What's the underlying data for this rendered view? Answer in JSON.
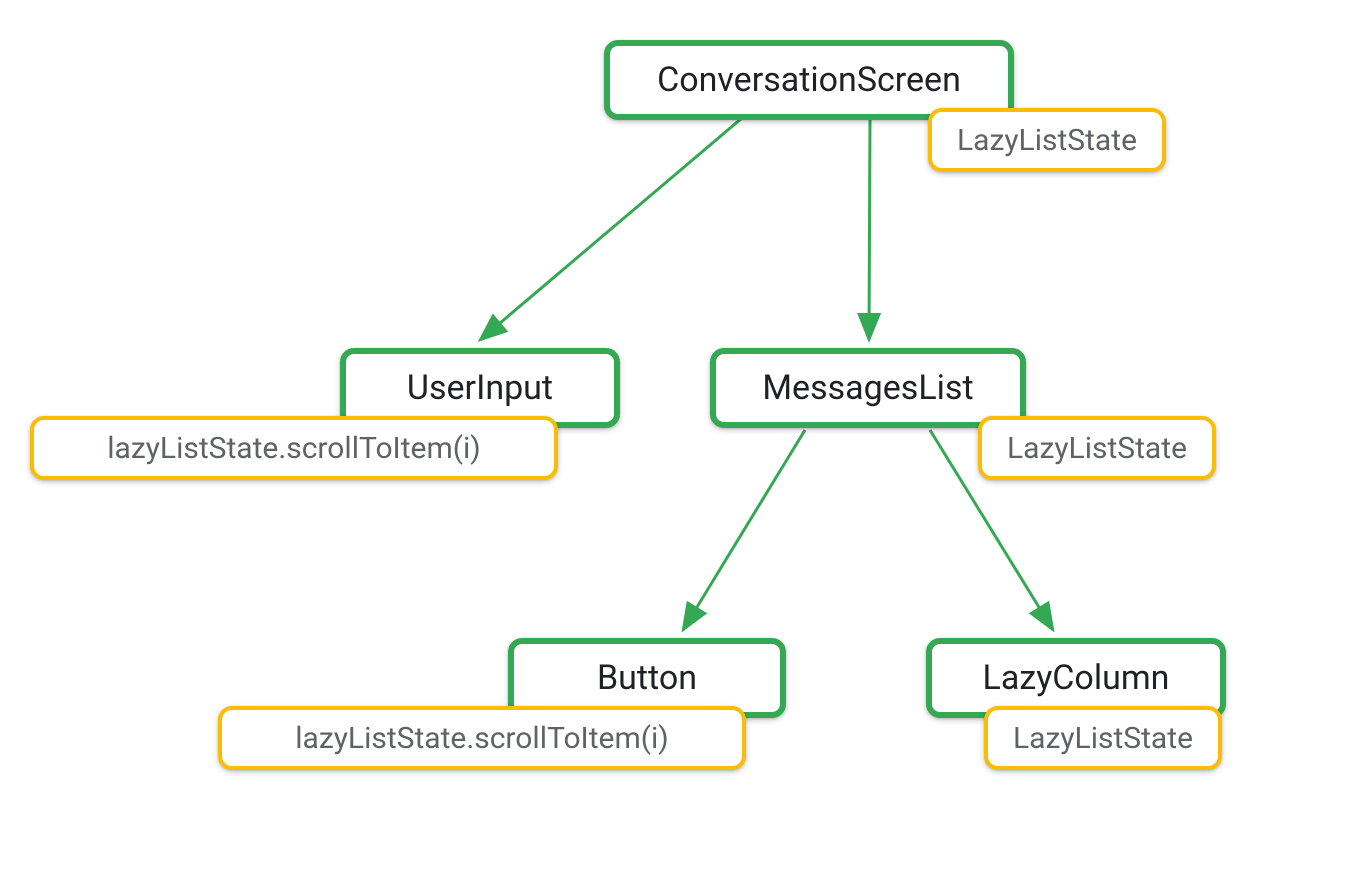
{
  "colors": {
    "green_border": "#34a853",
    "yellow_border": "#fbbc04",
    "text_primary": "#202124",
    "text_secondary": "#5f6368"
  },
  "diagram": {
    "root": {
      "label": "ConversationScreen",
      "badge": "LazyListState"
    },
    "left_child": {
      "label": "UserInput",
      "badge": "lazyListState.scrollToItem(i)"
    },
    "right_child": {
      "label": "MessagesList",
      "badge": "LazyListState"
    },
    "grandchild_left": {
      "label": "Button",
      "badge": "lazyListState.scrollToItem(i)"
    },
    "grandchild_right": {
      "label": "LazyColumn",
      "badge": "LazyListState"
    }
  }
}
